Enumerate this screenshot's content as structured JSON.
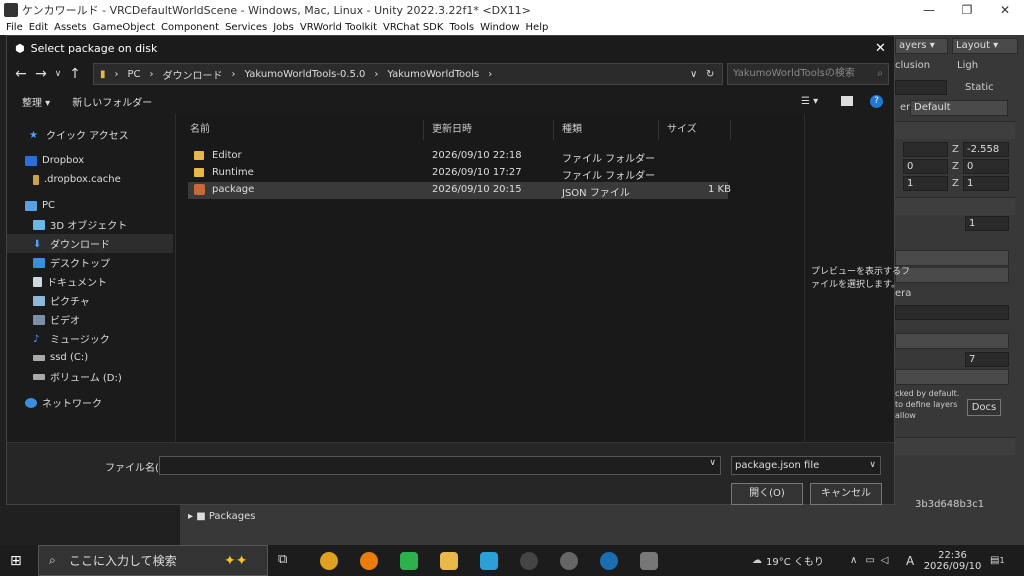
{
  "window": {
    "title": "ケンカワールド - VRCDefaultWorldScene - Windows, Mac, Linux - Unity 2022.3.22f1* <DX11>"
  },
  "menu": [
    "File",
    "Edit",
    "Assets",
    "GameObject",
    "Component",
    "Services",
    "Jobs",
    "VRWorld Toolkit",
    "VRChat SDK",
    "Tools",
    "Window",
    "Help"
  ],
  "unity_right": {
    "layers": "ayers",
    "layout": "Layout",
    "inclusion": "clusion",
    "light": "Ligh",
    "static": "Static",
    "default": "Default",
    "er": "er",
    "x1": "-2.558",
    "y0": "0",
    "z0": "0",
    "z1": "1",
    "y1": "1",
    "one": "1",
    "cam": "era",
    "seven": "7",
    "note1": "cked by default.",
    "note2": "to define layers",
    "note3": "allow",
    "docs": "Docs",
    "guid": "3b3d648b3c1"
  },
  "unity_bottom": {
    "packages": "Packages"
  },
  "dialog": {
    "title": "Select package on disk",
    "breadcrumb": [
      "PC",
      "ダウンロード",
      "YakumoWorldTools-0.5.0",
      "YakumoWorldTools"
    ],
    "search_placeholder": "YakumoWorldToolsの検索",
    "organize": "整理 ▾",
    "new_folder": "新しいフォルダー",
    "nav": [
      {
        "label": "クイック アクセス",
        "icon": "star-icon"
      },
      {
        "label": "Dropbox",
        "icon": "dropbox-icon"
      },
      {
        "label": ".dropbox.cache",
        "icon": "folder-icon"
      },
      {
        "label": "PC",
        "icon": "pc-icon"
      },
      {
        "label": "3D オブジェクト",
        "icon": "cube-icon"
      },
      {
        "label": "ダウンロード",
        "icon": "download-icon"
      },
      {
        "label": "デスクトップ",
        "icon": "desktop-icon"
      },
      {
        "label": "ドキュメント",
        "icon": "document-icon"
      },
      {
        "label": "ピクチャ",
        "icon": "picture-icon"
      },
      {
        "label": "ビデオ",
        "icon": "video-icon"
      },
      {
        "label": "ミュージック",
        "icon": "music-icon"
      },
      {
        "label": "ssd (C:)",
        "icon": "drive-icon"
      },
      {
        "label": "ボリューム (D:)",
        "icon": "drive-icon"
      },
      {
        "label": "ネットワーク",
        "icon": "network-icon"
      }
    ],
    "columns": [
      "名前",
      "更新日時",
      "種類",
      "サイズ"
    ],
    "files": [
      {
        "name": "Editor",
        "date": "2026/09/10 22:18",
        "type": "ファイル フォルダー",
        "size": ""
      },
      {
        "name": "Runtime",
        "date": "2026/09/10 17:27",
        "type": "ファイル フォルダー",
        "size": ""
      },
      {
        "name": "package",
        "date": "2026/09/10 20:15",
        "type": "JSON ファイル",
        "size": "1 KB"
      }
    ],
    "preview_line1": "プレビューを表示するフ",
    "preview_line2": "ァイルを選択します。",
    "filename_label": "ファイル名(N):",
    "filename_value": "",
    "filetype": "package.json file",
    "open": "開く(O)",
    "cancel": "キャンセル"
  },
  "taskbar": {
    "search": "ここに入力して検索",
    "weather": "19°C くもり",
    "ime": "A",
    "time": "22:36",
    "date": "2026/09/10",
    "notif": "1"
  }
}
